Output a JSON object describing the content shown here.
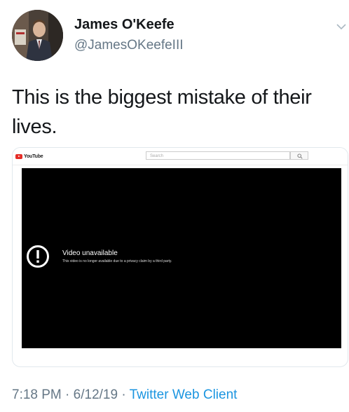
{
  "user": {
    "display_name": "James O'Keefe",
    "handle": "@JamesOKeefeIII"
  },
  "tweet": {
    "text": "This is the biggest mistake of their lives."
  },
  "embed": {
    "logo_text": "YouTube",
    "search_placeholder": "Search",
    "unavailable_title": "Video unavailable",
    "unavailable_message": "This video is no longer available due to a privacy claim by a third party."
  },
  "meta": {
    "time": "7:18 PM",
    "separator": "·",
    "date": "6/12/19",
    "source": "Twitter Web Client"
  },
  "colors": {
    "link": "#1b95e0",
    "secondary_text": "#657786",
    "youtube_red": "#e52d27"
  },
  "icons": {
    "caret": "chevron-down-icon",
    "warning": "exclamation-circle-icon",
    "search": "search-icon"
  }
}
